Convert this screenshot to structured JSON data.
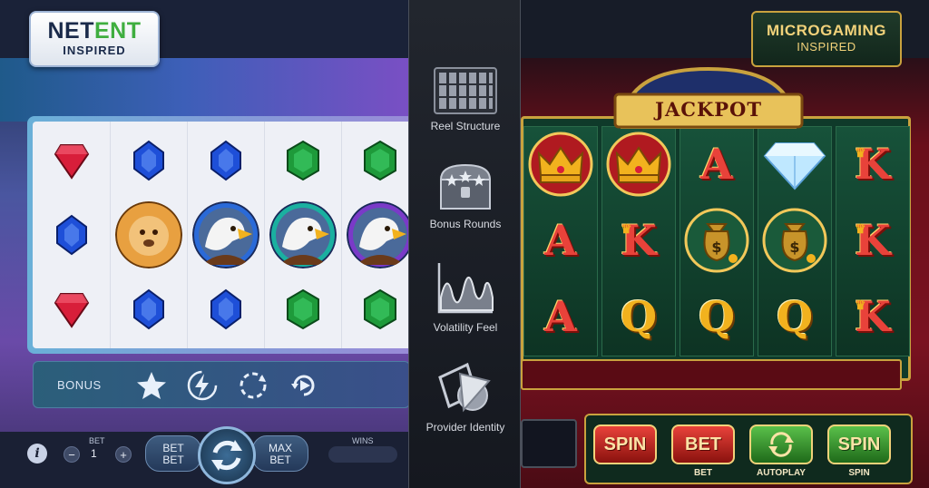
{
  "left_panel": {
    "logo": {
      "brand_part1": "NET",
      "brand_part2": "ENT",
      "subtitle": "INSPIRED"
    },
    "reels": [
      [
        "ruby",
        "sapphire",
        "ruby"
      ],
      [
        "sapphire",
        "lion",
        "sapphire"
      ],
      [
        "sapphire",
        "eagle",
        "sapphire"
      ],
      [
        "emerald",
        "eagle",
        "emerald"
      ],
      [
        "emerald",
        "eagle",
        "emerald"
      ]
    ],
    "bonus_bar": {
      "label": "BONUS",
      "icons": [
        "star-icon",
        "lightning-icon",
        "refresh-icon",
        "replay-icon"
      ]
    },
    "controls": {
      "info_label": "i",
      "bet_caption": "BET",
      "minus_label": "−",
      "bet_value": "1",
      "plus_label": "+",
      "bet_button_line1": "BET",
      "bet_button_line2": "BET",
      "max_bet_line1": "MAX",
      "max_bet_line2": "BET",
      "wins_caption": "WINS"
    },
    "colors": {
      "accent": "#8fb7dc",
      "ruby": "#d81e3a",
      "sapphire": "#1e4fd8",
      "emerald": "#1e9a3a"
    }
  },
  "center_panel": {
    "features": [
      {
        "label": "Reel Structure",
        "icon": "reel-grid-icon"
      },
      {
        "label": "Bonus Rounds",
        "icon": "treasure-chest-icon"
      },
      {
        "label": "Volatility Feel",
        "icon": "volatility-graph-icon"
      },
      {
        "label": "Provider Identity",
        "icon": "provider-shapes-icon"
      }
    ]
  },
  "right_panel": {
    "logo": {
      "brand": "MICROGAMING",
      "subtitle": "INSPIRED"
    },
    "jackpot_label": "JACKPOT",
    "reels": [
      [
        "crown",
        "A",
        "A"
      ],
      [
        "crown",
        "K",
        "Q"
      ],
      [
        "A",
        "money-bag",
        "Q"
      ],
      [
        "diamond",
        "money-bag",
        "Q"
      ],
      [
        "K",
        "K",
        "K"
      ]
    ],
    "buttons": [
      {
        "label": "SPIN",
        "caption": "",
        "style": "red"
      },
      {
        "label": "BET",
        "caption": "BET",
        "style": "red"
      },
      {
        "label": "",
        "caption": "AUTOPLAY",
        "style": "green"
      },
      {
        "label": "SPIN",
        "caption": "SPIN",
        "style": "green"
      }
    ],
    "colors": {
      "gold": "#c9a23e",
      "felt": "#0f3a2a",
      "red_bg": "#7a1220"
    }
  }
}
